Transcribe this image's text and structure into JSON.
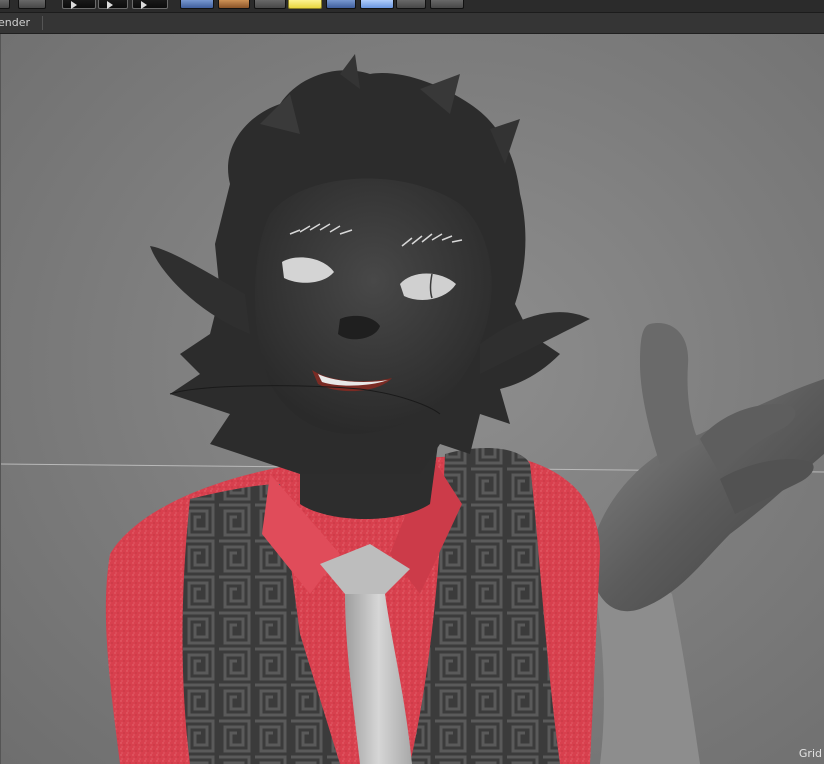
{
  "menubar": {
    "panel_label": "ender"
  },
  "toolbar": {
    "buttons": [
      {
        "icon": "render-region-icon"
      },
      {
        "icon": "render-view-icon"
      },
      {
        "icon": "render-to-picture-viewer-icon"
      },
      {
        "icon": "edit-render-settings-icon"
      },
      {
        "icon": "cube-primitive-icon"
      },
      {
        "icon": "subdivision-surface-icon"
      },
      {
        "icon": "spline-icon"
      },
      {
        "icon": "light-icon"
      },
      {
        "icon": "scene-object-icon"
      },
      {
        "icon": "floor-object-icon"
      },
      {
        "icon": "camera-icon"
      },
      {
        "icon": "deformer-icon"
      }
    ]
  },
  "viewport": {
    "grid_label": "Grid",
    "colors": {
      "background": "#7c7c7c",
      "skin": "#3a3a3a",
      "hair": "#2e2e2e",
      "shirt": "#d8404e",
      "vest": "#3d3d3d",
      "tie": "#c8c8c8",
      "hand": "#9a9a9a"
    }
  }
}
